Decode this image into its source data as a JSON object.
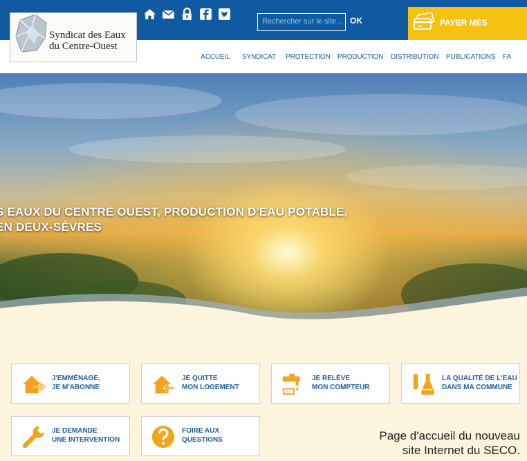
{
  "site": {
    "logo_line1": "Syndicat des Eaux",
    "logo_line2": "du Centre-Ouest"
  },
  "top_icons": [
    "home-icon",
    "mail-icon",
    "lock-icon",
    "facebook-icon",
    "twitter-icon"
  ],
  "search": {
    "placeholder": "Rechercher sur le site...",
    "button": "OK"
  },
  "pay_button": "PAYER MES",
  "nav": [
    "ACCUEIL",
    "SYNDICAT",
    "PROTECTION",
    "PRODUCTION",
    "DISTRIBUTION",
    "PUBLICATIONS",
    "FA"
  ],
  "hero": {
    "line1": "S EAUX DU CENTRE OUEST, PRODUCTION D'EAU POTABLE,",
    "line2": "EN DEUX-SÈVRES"
  },
  "cards": [
    {
      "line1": "J'EMMÉNAGE,",
      "line2": "JE M'ABONNE",
      "icon": "house-arrow-in-icon"
    },
    {
      "line1": "JE QUITTE",
      "line2": "MON LOGEMENT",
      "icon": "house-arrow-out-icon"
    },
    {
      "line1": "JE RELÈVE",
      "line2": "MON COMPTEUR",
      "icon": "water-meter-icon"
    },
    {
      "line1": "LA QUALITÉ DE L'EAU",
      "line2": "DANS MA COMMUNE",
      "icon": "lab-flask-icon"
    },
    {
      "line1": "JE DEMANDE",
      "line2": "UNE INTERVENTION",
      "icon": "wrench-icon"
    },
    {
      "line1": "FOIRE AUX",
      "line2": "QUESTIONS",
      "icon": "question-icon"
    }
  ],
  "caption": {
    "line1": "Page d'accueil du nouveau",
    "line2": "site Internet du SECO."
  },
  "colors": {
    "header_blue": "#0f5aa0",
    "pay_yellow": "#f6c10f",
    "accent_orange": "#f2a51c",
    "nav_blue": "#1d5ea4"
  }
}
